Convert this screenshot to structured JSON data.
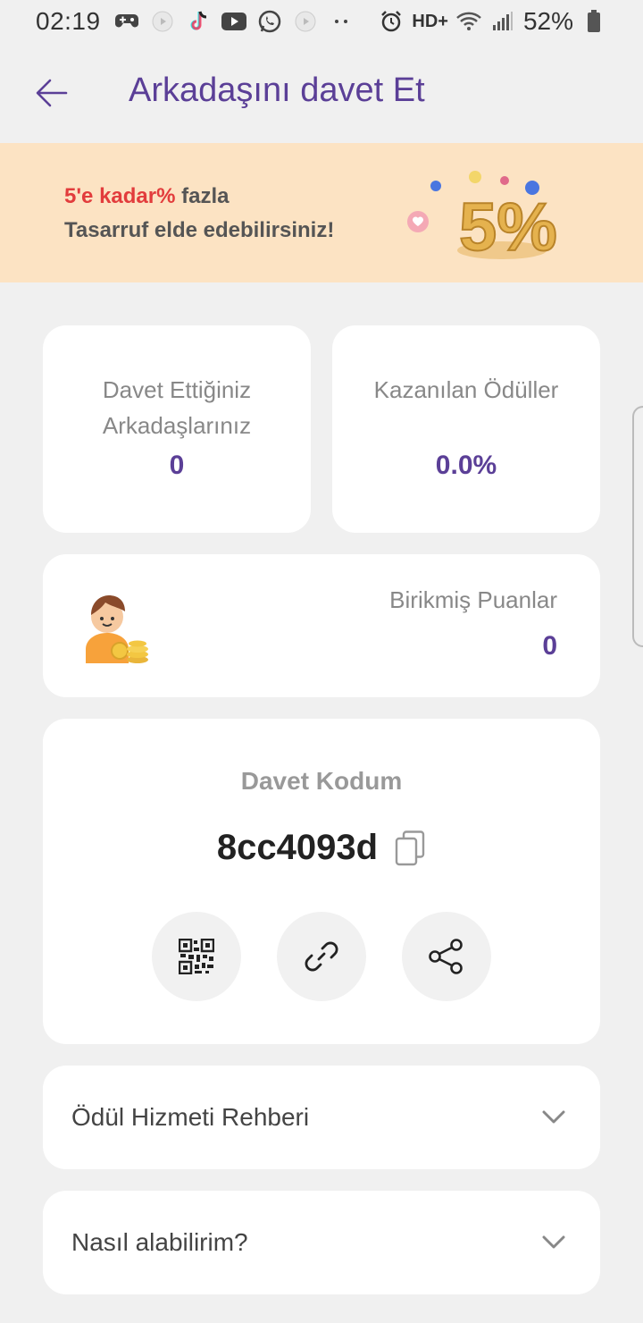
{
  "status_bar": {
    "time": "02:19",
    "network": "HD+",
    "battery": "52%"
  },
  "header": {
    "title": "Arkadaşını davet Et"
  },
  "banner": {
    "highlight": "5'e kadar%",
    "line1_rest": " fazla",
    "line2": "Tasarruf elde edebilirsiniz!",
    "art_text": "5%"
  },
  "stats": {
    "invited_label": "Davet Ettiğiniz Arkadaşlarınız",
    "invited_value": "0",
    "rewards_label": "Kazanılan Ödüller",
    "rewards_value": "0.0%"
  },
  "points": {
    "label": "Birikmiş Puanlar",
    "value": "0"
  },
  "invite_code": {
    "label": "Davet Kodum",
    "code": "8cc4093d"
  },
  "accordions": [
    {
      "label": "Ödül Hizmeti Rehberi"
    },
    {
      "label": "Nasıl alabilirim?"
    }
  ],
  "colors": {
    "accent": "#5b3f97",
    "banner_bg": "#fce3c3",
    "highlight_red": "#e23c3c",
    "page_bg": "#f0f0f0"
  },
  "icons": [
    "back-arrow-icon",
    "copy-icon",
    "qr-code-icon",
    "link-icon",
    "share-icon",
    "chevron-down-icon"
  ]
}
